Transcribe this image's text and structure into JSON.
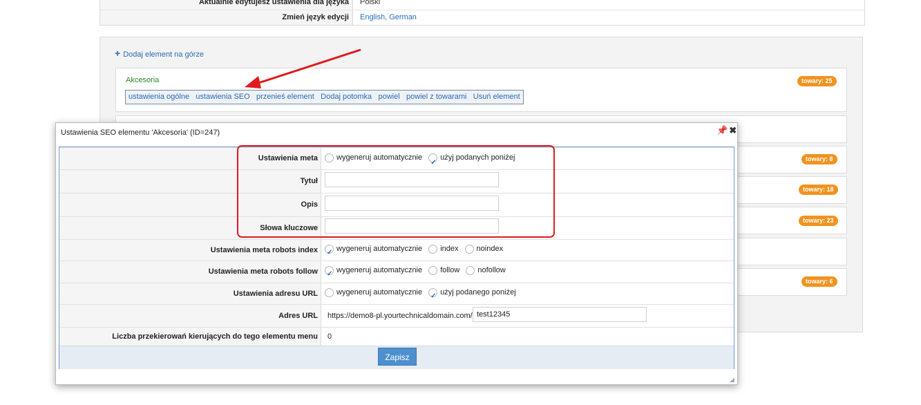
{
  "top_table": {
    "row1_label": "Aktualnie edytujesz ustawienia dla języka",
    "row1_value": "Polski",
    "row2_label": "Zmień język edycji",
    "row2_value": "English, German"
  },
  "tree": {
    "add_top_label": "Dodaj element na górze",
    "node_title": "Akcesoria",
    "toolbar": [
      "ustawienia ogólne",
      "ustawienia SEO",
      "przenieś element",
      "Dodaj potomka",
      "powiel",
      "powiel z towarami",
      "Usuń element"
    ],
    "badges": [
      "towary: 25",
      "towary: 8",
      "towary: 18",
      "towary: 23",
      "towary: 6"
    ]
  },
  "dialog": {
    "title": "Ustawienia SEO elementu 'Akcesoria' (ID=247)",
    "pin_icon": "pin-icon",
    "close_icon": "close-icon",
    "rows": {
      "meta_label": "Ustawienia meta",
      "meta_opt1": "wygeneruj automatycznie",
      "meta_opt2": "użyj podanych poniżej",
      "title_label": "Tytuł",
      "title_value": "",
      "desc_label": "Opis",
      "desc_value": "",
      "keywords_label": "Słowa kluczowe",
      "keywords_value": "",
      "robots_index_label": "Ustawienia meta robots index",
      "robots_index_opt1": "wygeneruj automatycznie",
      "robots_index_opt2": "index",
      "robots_index_opt3": "noindex",
      "robots_follow_label": "Ustawienia meta robots follow",
      "robots_follow_opt1": "wygeneruj automatycznie",
      "robots_follow_opt2": "follow",
      "robots_follow_opt3": "nofollow",
      "url_settings_label": "Ustawienia adresu URL",
      "url_settings_opt1": "wygeneruj automatycznie",
      "url_settings_opt2": "użyj podanego poniżej",
      "url_label": "Adres URL",
      "url_prefix": "https://demo8-pl.yourtechnicaldomain.com/",
      "url_value": "test12345",
      "redirects_label": "Liczba przekierowań kierujących do tego elementu menu",
      "redirects_value": "0"
    },
    "save_label": "Zapisz"
  },
  "colors": {
    "accent": "#2a6ab4",
    "badge": "#f0931e",
    "highlight": "#e0191d",
    "save_button": "#4e8fce"
  }
}
